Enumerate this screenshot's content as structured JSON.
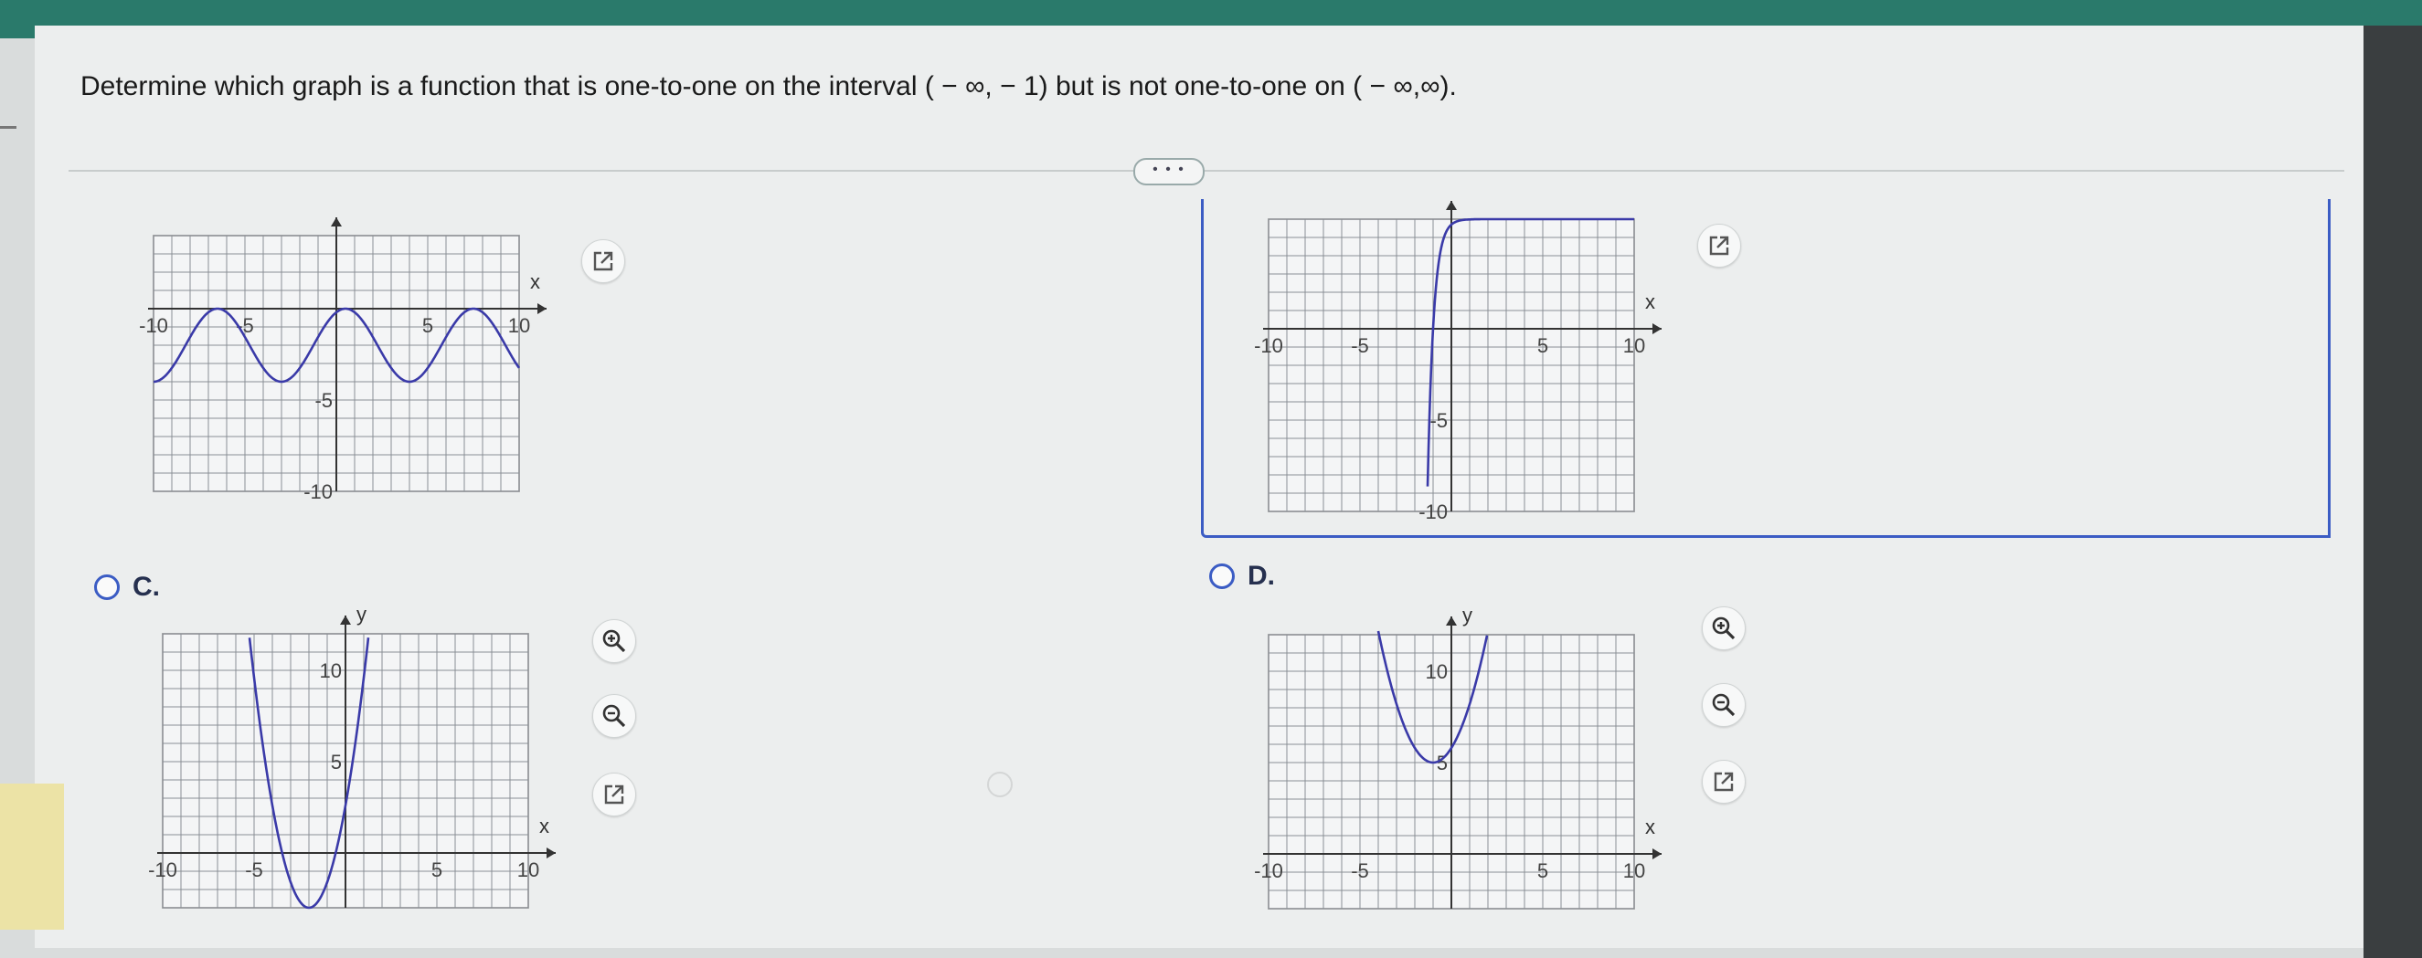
{
  "question": "Determine which graph is a function that is one-to-one on the interval ( − ∞, − 1) but is not one-to-one on ( − ∞,∞).",
  "more_button": "• • •",
  "options": [
    {
      "letter": "C.",
      "selected": false
    },
    {
      "letter": "D.",
      "selected": false
    }
  ],
  "graphs": [
    {
      "id": "top-left",
      "x_axis_label": "x",
      "y_axis_label": "",
      "x_tick_labels": [
        "-10",
        "-5",
        "5",
        "10"
      ],
      "y_tick_labels": [
        "-5",
        "-10"
      ],
      "curve": "sinusoid oscillating between 0 and -4"
    },
    {
      "id": "top-right",
      "x_axis_label": "x",
      "y_axis_label": "",
      "x_tick_labels": [
        "-10",
        "-5",
        "5",
        "10"
      ],
      "y_tick_labels": [
        "-5",
        "-10"
      ],
      "curve": "increasing curve near x = -1"
    },
    {
      "id": "option-c",
      "x_axis_label": "x",
      "y_axis_label": "y",
      "x_tick_labels": [
        "-10",
        "-5",
        "5",
        "10"
      ],
      "y_tick_labels": [
        "10",
        "5"
      ],
      "curve": "upward parabola with vertex near (-2, -3)"
    },
    {
      "id": "option-d",
      "x_axis_label": "x",
      "y_axis_label": "y",
      "x_tick_labels": [
        "-10",
        "-5",
        "5",
        "10"
      ],
      "y_tick_labels": [
        "10",
        "5"
      ],
      "curve": "upward parabola with vertex near (-1, 5)"
    }
  ],
  "icons": {
    "external": "external-link-icon",
    "zoom_in": "zoom-in-icon",
    "zoom_out": "zoom-out-icon"
  },
  "colors": {
    "curve": "#3a3aa8",
    "accent": "#3b5cc4",
    "topbar": "#2a7a6b"
  }
}
